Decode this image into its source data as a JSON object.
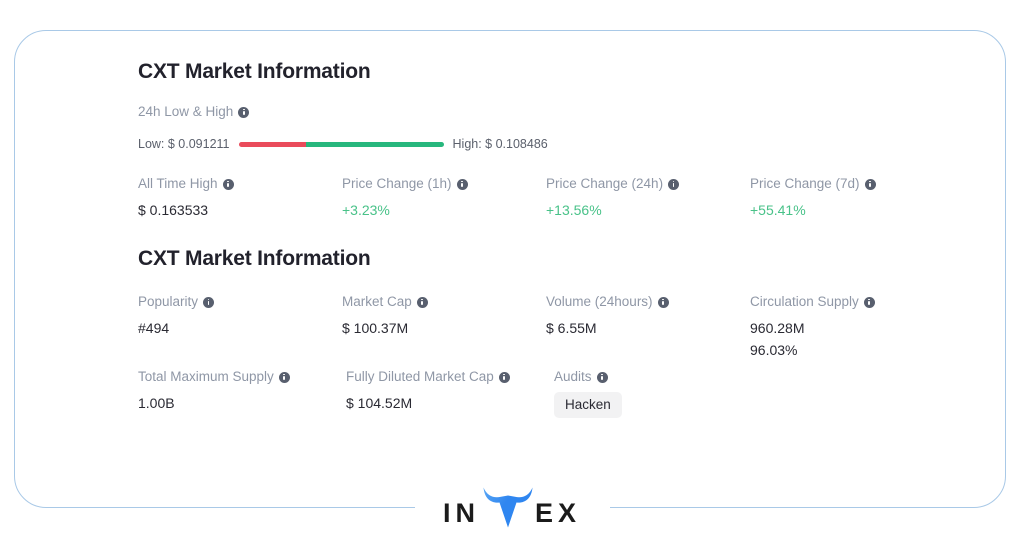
{
  "card": {
    "border_color": "#a9c9e7"
  },
  "section_1": {
    "title": "CXT Market Information",
    "low_high": {
      "label": "24h Low & High",
      "info_icon": "info-icon",
      "low_text": "Low: $ 0.091211",
      "high_text": "High: $ 0.108486",
      "low_color": "#ea4b5b",
      "high_color": "#27b77d",
      "low_percent": 33,
      "high_percent": 67
    },
    "fields": [
      {
        "label": "All Time High",
        "value": "$ 0.163533",
        "color": "#2a2a33"
      },
      {
        "label": "Price Change (1h)",
        "value": "+3.23%",
        "color": "#49c289"
      },
      {
        "label": "Price Change (24h)",
        "value": "+13.56%",
        "color": "#49c289"
      },
      {
        "label": "Price Change (7d)",
        "value": "+55.41%",
        "color": "#49c289"
      }
    ]
  },
  "section_2": {
    "title": "CXT Market Information",
    "row_1": [
      {
        "label": "Popularity",
        "value": "#494"
      },
      {
        "label": "Market Cap",
        "value": "$ 100.37M"
      },
      {
        "label": "Volume (24hours)",
        "value": "$ 6.55M"
      },
      {
        "label": "Circulation Supply",
        "value": "960.28M",
        "value2": "96.03%"
      }
    ],
    "row_2": [
      {
        "label": "Total Maximum Supply",
        "value": "1.00B"
      },
      {
        "label": "Fully Diluted Market Cap",
        "value": "$ 104.52M"
      },
      {
        "label": "Audits",
        "badge": "Hacken"
      }
    ]
  },
  "footer": {
    "logo_part_1": "IN",
    "logo_part_2": "EX",
    "logo_bull_color": "#2f86f0",
    "logo_text_color": "#1b1b1b"
  }
}
